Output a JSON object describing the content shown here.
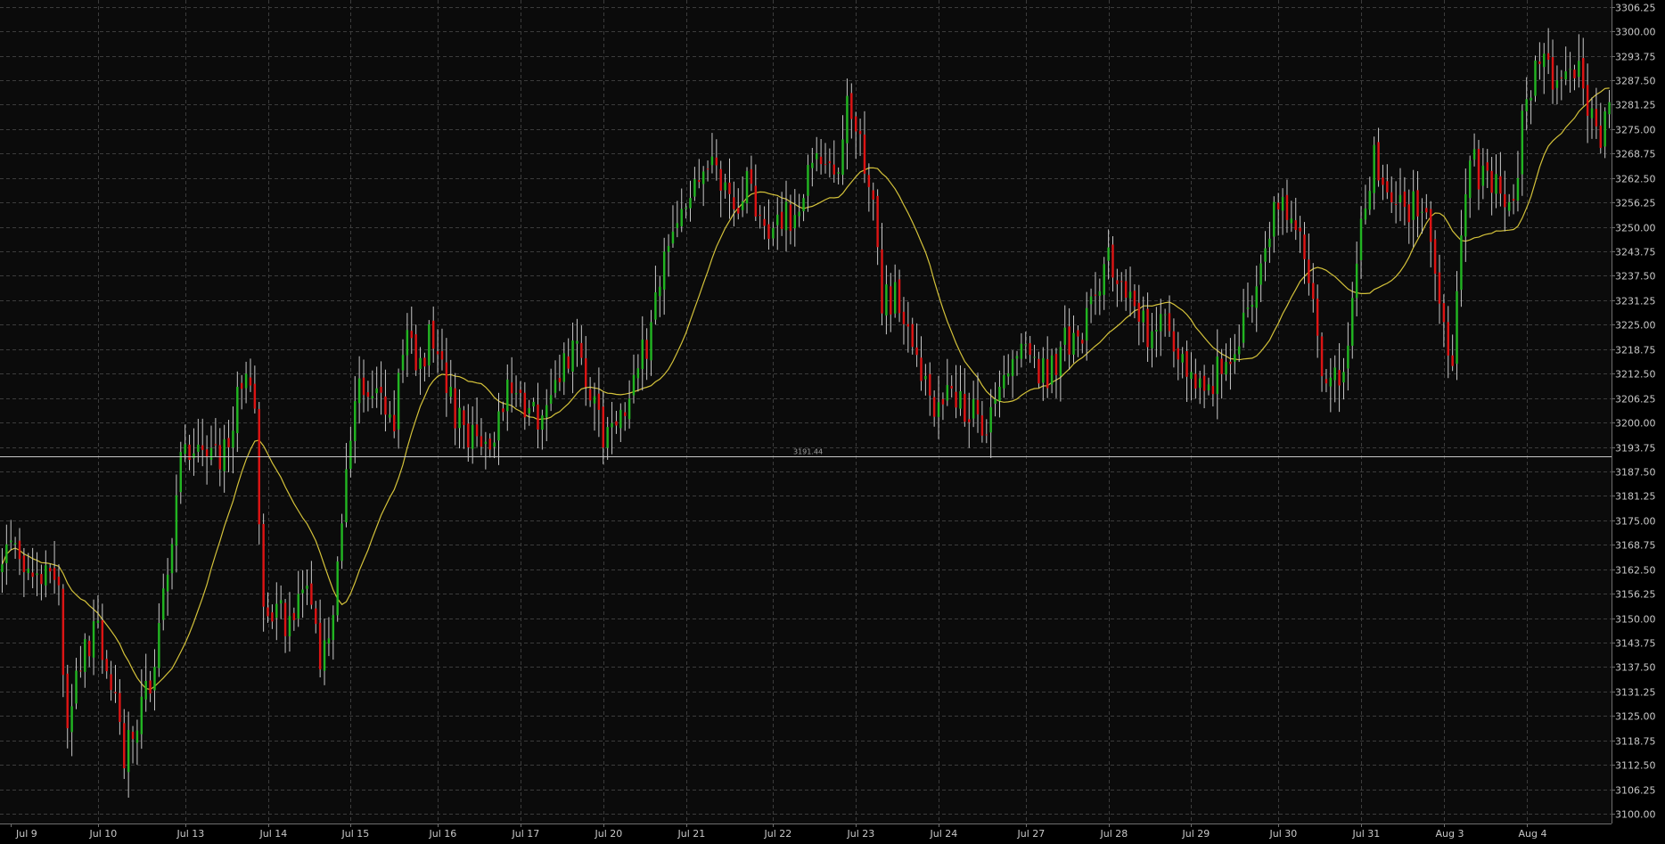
{
  "chart_data": {
    "type": "candlestick",
    "price_axis": {
      "ylim": [
        3097.5,
        3308.0
      ],
      "ticks": [
        3100.0,
        3106.25,
        3112.5,
        3118.75,
        3125.0,
        3131.25,
        3137.5,
        3143.75,
        3150.0,
        3156.25,
        3162.5,
        3168.75,
        3175.0,
        3181.25,
        3187.5,
        3193.75,
        3200.0,
        3206.25,
        3212.5,
        3218.75,
        3225.0,
        3231.25,
        3237.5,
        3243.75,
        3250.0,
        3256.25,
        3262.5,
        3268.75,
        3275.0,
        3281.25,
        3287.5,
        3293.75,
        3300.0,
        3306.25
      ],
      "tick_labels": [
        "3100.00",
        "3106.25",
        "3112.50",
        "3118.75",
        "3125.00",
        "3131.25",
        "3137.50",
        "3143.75",
        "3150.00",
        "3156.25",
        "3162.50",
        "3168.75",
        "3175.00",
        "3181.25",
        "3187.50",
        "3193.75",
        "3200.00",
        "3206.25",
        "3212.50",
        "3218.75",
        "3225.00",
        "3231.25",
        "3237.50",
        "3243.75",
        "3250.00",
        "3256.25",
        "3262.50",
        "3268.75",
        "3275.00",
        "3281.25",
        "3287.50",
        "3293.75",
        "3300.00",
        "3306.25"
      ]
    },
    "time_axis": {
      "labels": [
        "Jul 9",
        "Jul 10",
        "Jul 13",
        "Jul 14",
        "Jul 15",
        "Jul 16",
        "Jul 17",
        "Jul 20",
        "Jul 21",
        "Jul 22",
        "Jul 23",
        "Jul 24",
        "Jul 27",
        "Jul 28",
        "Jul 29",
        "Jul 30",
        "Jul 31",
        "Aug 3",
        "Aug 4"
      ]
    },
    "price_anchors": [
      [
        0,
        3165
      ],
      [
        2,
        3168
      ],
      [
        6,
        3160
      ],
      [
        10,
        3162
      ],
      [
        13,
        3158
      ],
      [
        15,
        3120
      ],
      [
        18,
        3140
      ],
      [
        22,
        3148
      ],
      [
        26,
        3130
      ],
      [
        28,
        3116
      ],
      [
        31,
        3125
      ],
      [
        34,
        3134
      ],
      [
        38,
        3160
      ],
      [
        41,
        3192
      ],
      [
        45,
        3196
      ],
      [
        49,
        3190
      ],
      [
        53,
        3200
      ],
      [
        56,
        3216
      ],
      [
        58,
        3205
      ],
      [
        60,
        3150
      ],
      [
        63,
        3152
      ],
      [
        66,
        3147
      ],
      [
        70,
        3158
      ],
      [
        73,
        3138
      ],
      [
        76,
        3152
      ],
      [
        79,
        3188
      ],
      [
        82,
        3208
      ],
      [
        86,
        3207
      ],
      [
        90,
        3202
      ],
      [
        93,
        3228
      ],
      [
        95,
        3210
      ],
      [
        98,
        3221
      ],
      [
        101,
        3212
      ],
      [
        105,
        3200
      ],
      [
        108,
        3196
      ],
      [
        111,
        3194
      ],
      [
        114,
        3200
      ],
      [
        117,
        3210
      ],
      [
        120,
        3205
      ],
      [
        123,
        3201
      ],
      [
        126,
        3210
      ],
      [
        129,
        3214
      ],
      [
        132,
        3218
      ],
      [
        135,
        3210
      ],
      [
        138,
        3198
      ],
      [
        141,
        3197
      ],
      [
        145,
        3210
      ],
      [
        149,
        3224
      ],
      [
        152,
        3243
      ],
      [
        156,
        3251
      ],
      [
        159,
        3262
      ],
      [
        162,
        3268
      ],
      [
        164,
        3266
      ],
      [
        168,
        3253
      ],
      [
        171,
        3261
      ],
      [
        174,
        3252
      ],
      [
        176,
        3244
      ],
      [
        179,
        3252
      ],
      [
        183,
        3253
      ],
      [
        186,
        3266
      ],
      [
        189,
        3262
      ],
      [
        192,
        3267
      ],
      [
        194,
        3282
      ],
      [
        197,
        3270
      ],
      [
        200,
        3254
      ],
      [
        202,
        3232
      ],
      [
        205,
        3232
      ],
      [
        208,
        3225
      ],
      [
        211,
        3212
      ],
      [
        214,
        3205
      ],
      [
        218,
        3208
      ],
      [
        222,
        3203
      ],
      [
        226,
        3198
      ],
      [
        229,
        3208
      ],
      [
        232,
        3220
      ],
      [
        236,
        3215
      ],
      [
        240,
        3213
      ],
      [
        244,
        3220
      ],
      [
        248,
        3224
      ],
      [
        251,
        3231
      ],
      [
        254,
        3241
      ],
      [
        257,
        3232
      ],
      [
        260,
        3230
      ],
      [
        263,
        3223
      ],
      [
        266,
        3230
      ],
      [
        269,
        3214
      ],
      [
        272,
        3213
      ],
      [
        276,
        3206
      ],
      [
        280,
        3216
      ],
      [
        284,
        3220
      ],
      [
        287,
        3232
      ],
      [
        290,
        3247
      ],
      [
        293,
        3256
      ],
      [
        296,
        3252
      ],
      [
        298,
        3245
      ],
      [
        301,
        3232
      ],
      [
        303,
        3215
      ],
      [
        305,
        3212
      ],
      [
        307,
        3208
      ],
      [
        309,
        3222
      ],
      [
        312,
        3248
      ],
      [
        315,
        3268
      ],
      [
        318,
        3262
      ],
      [
        322,
        3255
      ],
      [
        325,
        3257
      ],
      [
        328,
        3250
      ],
      [
        331,
        3226
      ],
      [
        333,
        3216
      ],
      [
        335,
        3245
      ],
      [
        337,
        3268
      ],
      [
        340,
        3262
      ],
      [
        344,
        3260
      ],
      [
        347,
        3258
      ],
      [
        350,
        3284
      ],
      [
        353,
        3292
      ],
      [
        356,
        3288
      ],
      [
        359,
        3286
      ],
      [
        362,
        3289
      ],
      [
        364,
        3278
      ],
      [
        367,
        3274
      ],
      [
        369,
        3278
      ]
    ],
    "moving_average": {
      "color": "#d4c23a"
    },
    "horizontal_line": {
      "value": 3191.44,
      "label": "3191.44",
      "color": "#c8c8c8"
    },
    "colors": {
      "up": "#22b422",
      "down": "#dc1414",
      "wick": "#c8c8c8",
      "background": "#0b0b0b",
      "grid": "#3c3c3c",
      "text": "#c8c8c8"
    },
    "grid": true
  }
}
